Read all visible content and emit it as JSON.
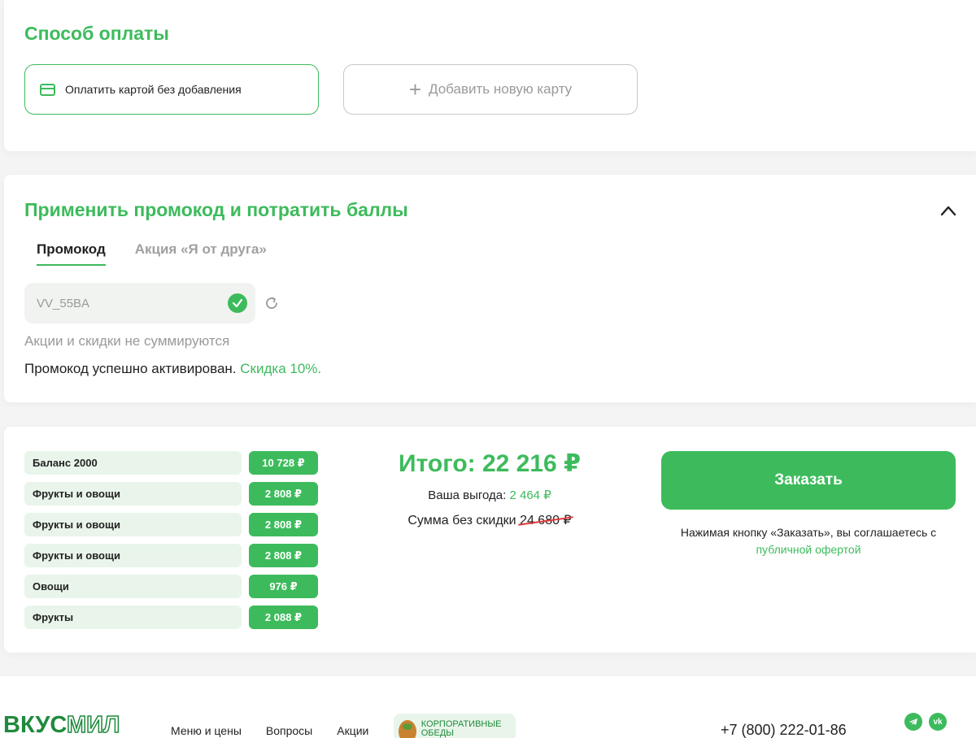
{
  "payment": {
    "title": "Способ оплаты",
    "option_card_label": "Оплатить картой без добавления",
    "option_add_label": "Добавить новую карту"
  },
  "promo": {
    "title": "Применить промокод и потратить баллы",
    "tabs": [
      {
        "label": "Промокод",
        "active": true
      },
      {
        "label": "Акция «Я от друга»",
        "active": false
      }
    ],
    "code_value": "VV_55BA",
    "note": "Акции и скидки не суммируются",
    "success_text": "Промокод успешно активирован.",
    "discount_text": "Скидка 10%."
  },
  "summary": {
    "lines": [
      {
        "name": "Баланс 2000",
        "price": "10 728 ₽"
      },
      {
        "name": "Фрукты и овощи",
        "price": "2 808 ₽"
      },
      {
        "name": "Фрукты и овощи",
        "price": "2 808 ₽"
      },
      {
        "name": "Фрукты и овощи",
        "price": "2 808 ₽"
      },
      {
        "name": "Овощи",
        "price": "976 ₽"
      },
      {
        "name": "Фрукты",
        "price": "2 088 ₽"
      }
    ],
    "total": "Итого: 22 216 ₽",
    "benefit_label": "Ваша выгода:",
    "benefit_value": "2 464 ₽",
    "nodiscount_label": "Сумма без скидки",
    "nodiscount_value": "24 680 ₽",
    "order_button": "Заказать",
    "agree_text": "Нажимая кнопку «Заказать», вы соглашаетесь с",
    "agree_link": "публичной офертой"
  },
  "footer": {
    "logo_part1": "ВКУС",
    "logo_part2": "МИЛ",
    "nav": [
      "Меню и цены",
      "Вопросы",
      "Акции"
    ],
    "corporate": "Корпоративные обеды",
    "phone": "+7 (800) 222-01-86",
    "social": [
      "telegram-icon",
      "vk-icon"
    ]
  },
  "colors": {
    "accent": "#3dbb5c",
    "accent_light": "#e9f5ea",
    "strike": "#e03c3c"
  }
}
